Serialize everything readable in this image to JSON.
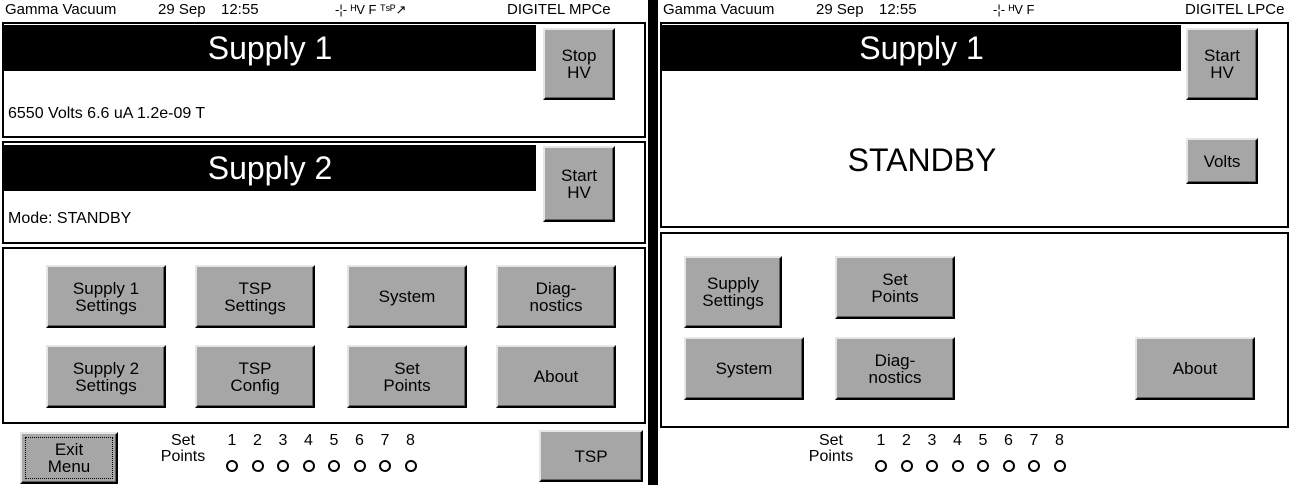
{
  "mpc": {
    "status": {
      "brand": "Gamma Vacuum",
      "date": "29 Sep",
      "time": "12:55",
      "icons": "-¦- ᴴV F ᵀˢᴾ↗",
      "model": "DIGITEL MPCe"
    },
    "supply1": {
      "title": "Supply 1",
      "readout": "6550 Volts  6.6 uA  1.2e-09 T",
      "button": "Stop\nHV"
    },
    "supply2": {
      "title": "Supply 2",
      "readout": "Mode: STANDBY",
      "button": "Start\nHV"
    },
    "menu": [
      "Supply 1\nSettings",
      "TSP\nSettings",
      "System",
      "Diag-\nnostics",
      "Supply 2\nSettings",
      "TSP\nConfig",
      "Set\nPoints",
      "About"
    ],
    "footer": {
      "exit": "Exit\nMenu",
      "setpoints_label": "Set\nPoints",
      "numbers": [
        "1",
        "2",
        "3",
        "4",
        "5",
        "6",
        "7",
        "8"
      ],
      "tsp": "TSP"
    }
  },
  "lpc": {
    "status": {
      "brand": "Gamma Vacuum",
      "date": "29 Sep",
      "time": "12:55",
      "icons": "-¦- ᴴV F",
      "model": "DIGITEL LPCe"
    },
    "supply1": {
      "title": "Supply 1",
      "mode": "STANDBY",
      "start_button": "Start\nHV",
      "volts_button": "Volts"
    },
    "menu": {
      "supply_settings": "Supply\nSettings",
      "set_points": "Set\nPoints",
      "system": "System",
      "diagnostics": "Diag-\nnostics",
      "about": "About"
    },
    "footer": {
      "setpoints_label": "Set\nPoints",
      "numbers": [
        "1",
        "2",
        "3",
        "4",
        "5",
        "6",
        "7",
        "8"
      ]
    }
  }
}
